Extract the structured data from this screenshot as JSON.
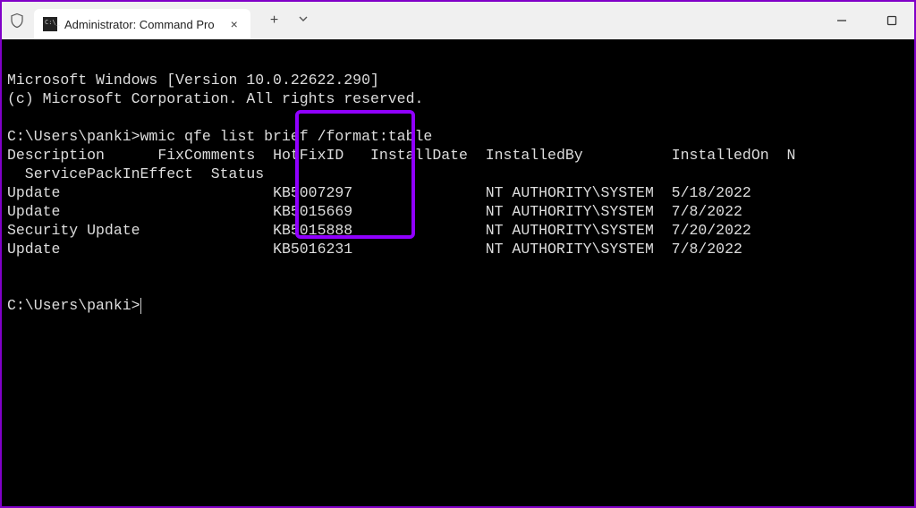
{
  "window": {
    "tab_title": "Administrator: Command Pro",
    "close_label": "×",
    "newtab_label": "+",
    "chevron_label": "⌄",
    "minimize_label": "—",
    "maximize_label": "▢"
  },
  "terminal": {
    "banner_line1": "Microsoft Windows [Version 10.0.22622.290]",
    "banner_line2": "(c) Microsoft Corporation. All rights reserved.",
    "prompt_path": "C:\\Users\\panki>",
    "command": "wmic qfe list brief /format:table",
    "headers": {
      "description": "Description",
      "fixcomments": "FixComments",
      "hotfixid": "HotFixID",
      "installdate": "InstallDate",
      "installedby": "InstalledBy",
      "installedon": "InstalledOn",
      "n": "N"
    },
    "header_wrap": "  ServicePackInEffect  Status",
    "rows": [
      {
        "description": "Update",
        "hotfixid": "KB5007297",
        "installedby": "NT AUTHORITY\\SYSTEM",
        "installedon": "5/18/2022"
      },
      {
        "description": "Update",
        "hotfixid": "KB5015669",
        "installedby": "NT AUTHORITY\\SYSTEM",
        "installedon": "7/8/2022"
      },
      {
        "description": "Security Update",
        "hotfixid": "KB5015888",
        "installedby": "NT AUTHORITY\\SYSTEM",
        "installedon": "7/20/2022"
      },
      {
        "description": "Update",
        "hotfixid": "KB5016231",
        "installedby": "NT AUTHORITY\\SYSTEM",
        "installedon": "7/8/2022"
      }
    ]
  }
}
